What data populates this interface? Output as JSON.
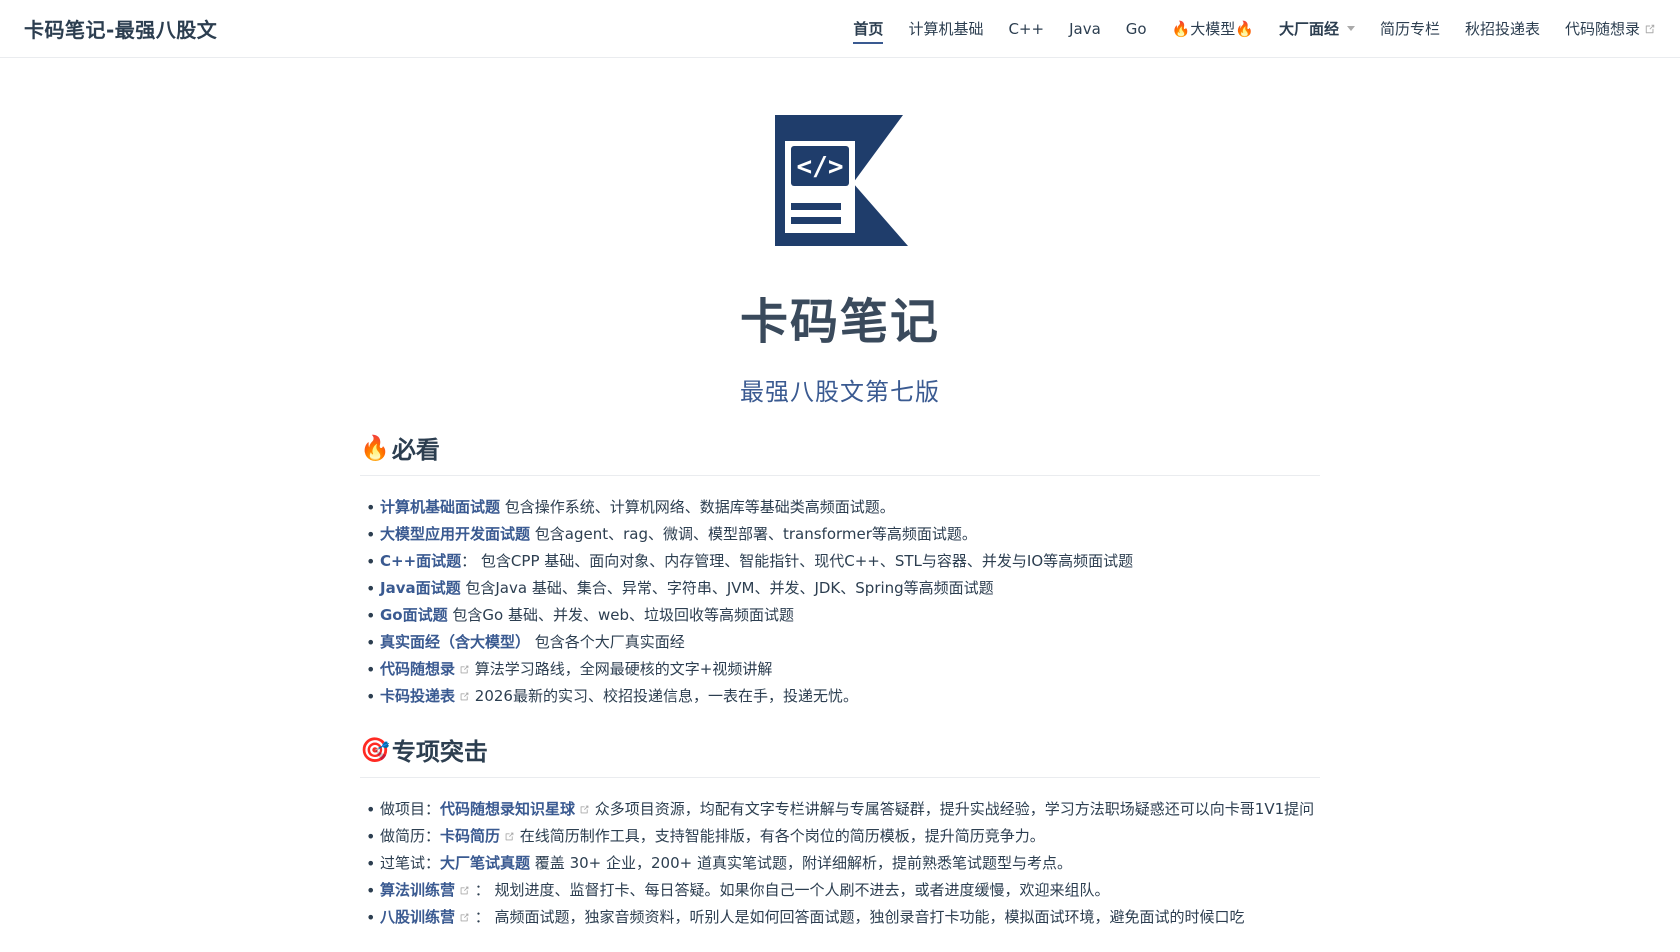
{
  "navbar": {
    "site_title": "卡码笔记-最强八股文",
    "items": [
      {
        "label": "首页"
      },
      {
        "label": "计算机基础"
      },
      {
        "label": "C++"
      },
      {
        "label": "Java"
      },
      {
        "label": "Go"
      },
      {
        "label": "🔥大模型🔥"
      },
      {
        "label": "大厂面经"
      },
      {
        "label": "简历专栏"
      },
      {
        "label": "秋招投递表"
      },
      {
        "label": "代码随想录"
      }
    ]
  },
  "hero": {
    "title": "卡码笔记",
    "description": "最强八股文第七版"
  },
  "sections": [
    {
      "emoji": "🔥",
      "title": "必看",
      "items": [
        {
          "link": "计算机基础面试题",
          "desc": " 包含操作系统、计算机网络、数据库等基础类高频面试题。"
        },
        {
          "link": "大模型应用开发面试题",
          "desc": " 包含agent、rag、微调、模型部署、transformer等高频面试题。"
        },
        {
          "link": "C++面试题",
          "desc": "： 包含CPP 基础、面向对象、内存管理、智能指针、现代C++、STL与容器、并发与IO等高频面试题"
        },
        {
          "link": "Java面试题",
          "desc": " 包含Java 基础、集合、异常、字符串、JVM、并发、JDK、Spring等高频面试题"
        },
        {
          "link": "Go面试题",
          "desc": " 包含Go 基础、并发、web、垃圾回收等高频面试题"
        },
        {
          "link": "真实面经（含大模型）",
          "desc": " 包含各个大厂真实面经"
        },
        {
          "link": "代码随想录",
          "desc": " 算法学习路线，全网最硬核的文字+视频讲解"
        },
        {
          "link": "卡码投递表",
          "desc": " 2026最新的实习、校招投递信息，一表在手，投递无忧。"
        }
      ]
    },
    {
      "emoji": "🎯",
      "title": "专项突击",
      "items": [
        {
          "prefix": "做项目：",
          "link": "代码随想录知识星球",
          "desc": " 众多项目资源，均配有文字专栏讲解与专属答疑群，提升实战经验，学习方法职场疑惑还可以向卡哥1V1提问"
        },
        {
          "prefix": "做简历：",
          "link": "卡码简历",
          "desc": " 在线简历制作工具，支持智能排版，有各个岗位的简历模板，提升简历竞争力。"
        },
        {
          "prefix": "过笔试：",
          "link": "大厂笔试真题",
          "desc": " 覆盖 30+ 企业，200+ 道真实笔试题，附详细解析，提前熟悉笔试题型与考点。"
        },
        {
          "link": "算法训练营",
          "desc": " ： 规划进度、监督打卡、每日答疑。如果你自己一个人刷不进去，或者进度缓慢，欢迎来组队。"
        },
        {
          "link": "八股训练营",
          "desc": " ： 高频面试题，独家音频资料，听别人是如何回答面试题，独创录音打卡功能，模拟面试环境，避免面试的时候口吃"
        }
      ]
    }
  ]
}
